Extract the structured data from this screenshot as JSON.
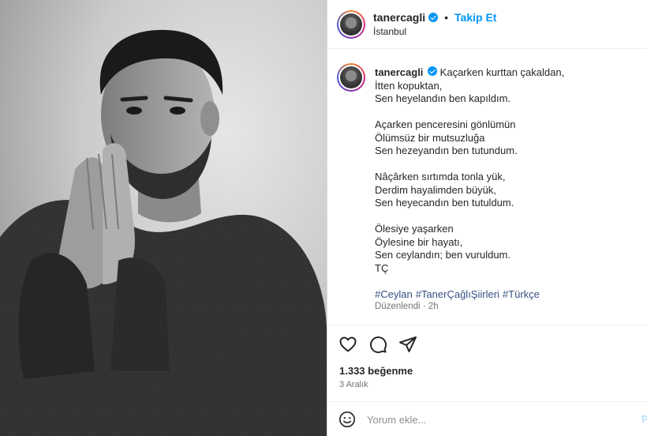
{
  "post": {
    "username": "tanercagli",
    "follow_label": "Takip Et",
    "separator": "•",
    "location": "İstanbul",
    "caption_lines": [
      [
        "Kaçarken kurttan çakaldan,",
        "İtten kopuktan,",
        "Sen heyelandın ben kapıldım."
      ],
      [
        "Açarken penceresini gönlümün",
        "Ölümsüz bir mutsuzluğa",
        "Sen hezeyandın ben tutundum."
      ],
      [
        "Nâçârken sırtımda tonla yük,",
        "Derdim hayalimden büyük,",
        "Sen heyecandın ben tutuldum."
      ],
      [
        "Ölesiye yaşarken",
        "Öylesine bir hayatı,",
        "Sen ceylandın; ben vuruldum.",
        "TÇ"
      ]
    ],
    "hashtags": [
      "#Ceylan",
      "#TanerÇağlıŞiirleri",
      "#Türkçe"
    ],
    "edited_label": "Düzenlendi",
    "edited_time": "2h",
    "likes": "1.333 beğenme",
    "date": "3 Aralık",
    "comment_placeholder": "Yorum ekle...",
    "post_button": "P"
  },
  "icons": {
    "verified": "verified-badge-icon",
    "like": "heart-icon",
    "comment": "comment-bubble-icon",
    "share": "paper-plane-icon",
    "emoji": "smiley-icon"
  },
  "colors": {
    "accent": "#0095f6",
    "hashtag": "#385185",
    "muted": "#737373"
  }
}
